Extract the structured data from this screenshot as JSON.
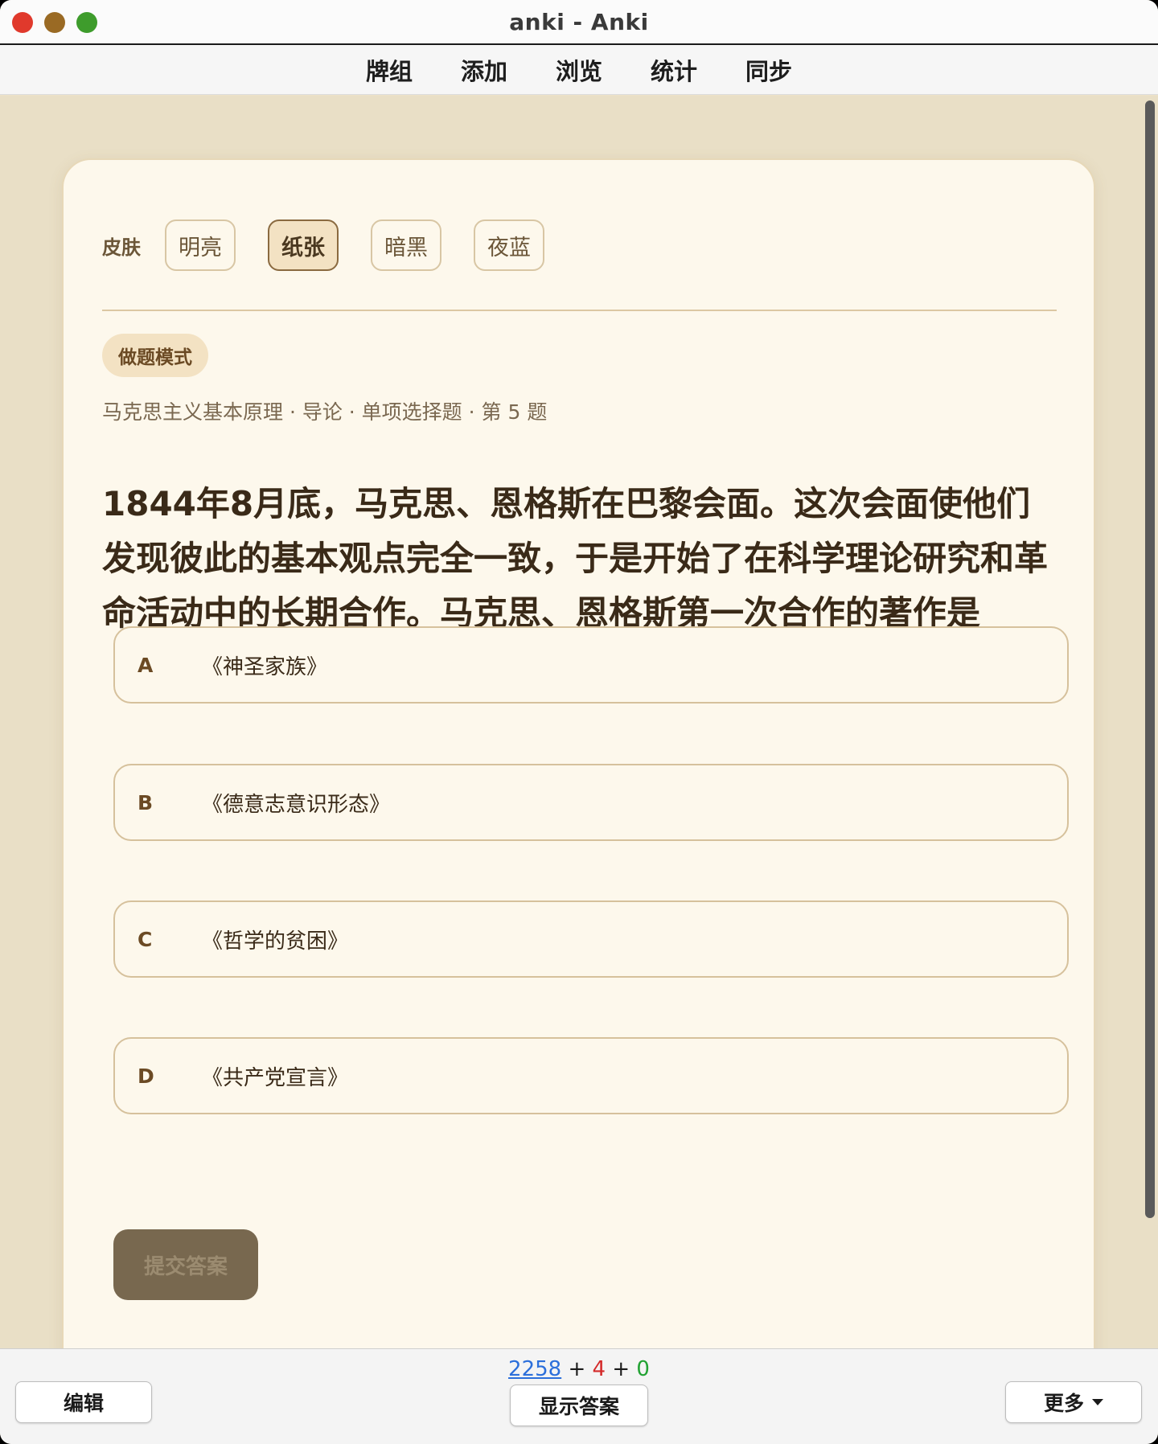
{
  "window": {
    "title": "anki - Anki"
  },
  "menu": [
    "牌组",
    "添加",
    "浏览",
    "统计",
    "同步"
  ],
  "skin": {
    "label": "皮肤",
    "options": [
      "明亮",
      "纸张",
      "暗黑",
      "夜蓝"
    ],
    "selected": "纸张"
  },
  "mode_badge": "做题模式",
  "breadcrumb": "马克思主义基本原理 · 导论 · 单项选择题 · 第 5 题",
  "question": "1844年8月底，马克思、恩格斯在巴黎会面。这次会面使他们发现彼此的基本观点完全一致，于是开始了在科学理论研究和革命活动中的长期合作。马克思、恩格斯第一次合作的著作是",
  "options": [
    {
      "letter": "A",
      "text": "《神圣家族》"
    },
    {
      "letter": "B",
      "text": "《德意志意识形态》"
    },
    {
      "letter": "C",
      "text": "《哲学的贫困》"
    },
    {
      "letter": "D",
      "text": "《共产党宣言》"
    }
  ],
  "submit_label": "提交答案",
  "counts": {
    "new": "2258",
    "learning": "4",
    "review": "0",
    "sep": "+"
  },
  "bottom": {
    "edit": "编辑",
    "show_answer": "显示答案",
    "more": "更多"
  },
  "colors": {
    "new": "#2c6fdb",
    "learning": "#d42a2a",
    "review": "#22a233",
    "paper_bg": "#e9dfc6",
    "card_bg": "#fdf8ec"
  }
}
